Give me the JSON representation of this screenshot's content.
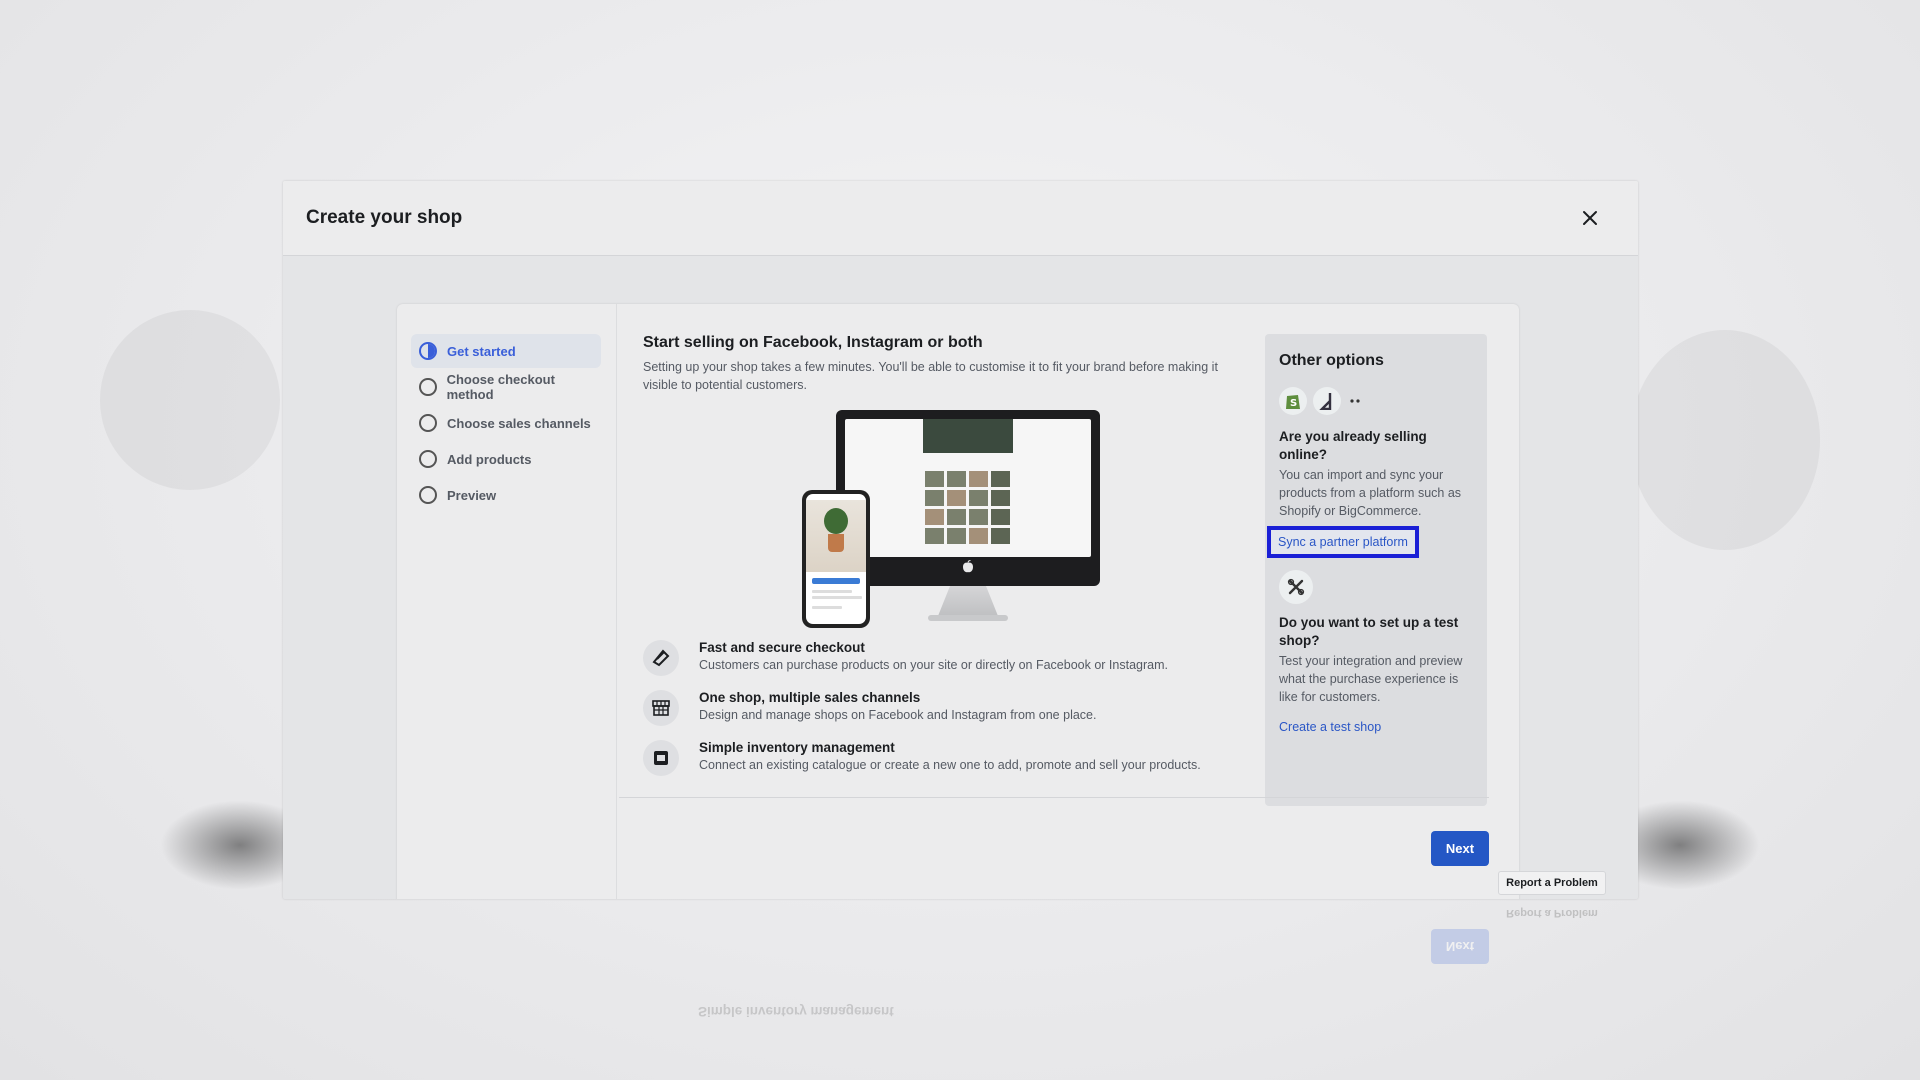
{
  "modal": {
    "title": "Create your shop"
  },
  "steps": [
    {
      "label": "Get started",
      "active": true
    },
    {
      "label": "Choose checkout method",
      "active": false
    },
    {
      "label": "Choose sales channels",
      "active": false
    },
    {
      "label": "Add products",
      "active": false
    },
    {
      "label": "Preview",
      "active": false
    }
  ],
  "main": {
    "heading": "Start selling on Facebook, Instagram or both",
    "description": "Setting up your shop takes a few minutes. You'll be able to customise it to fit your brand before making it visible to potential customers.",
    "features": [
      {
        "icon": "card-icon",
        "title": "Fast and secure checkout",
        "description": "Customers can purchase products on your site or directly on Facebook or Instagram."
      },
      {
        "icon": "storefront-icon",
        "title": "One shop, multiple sales channels",
        "description": "Design and manage shops on Facebook and Instagram from one place."
      },
      {
        "icon": "inventory-icon",
        "title": "Simple inventory management",
        "description": "Connect an existing catalogue or create a new one to add, promote and sell your products."
      }
    ]
  },
  "other_options": {
    "title": "Other options",
    "partner_question": "Are you already selling online?",
    "partner_text": "You can import and sync your products from a platform such as Shopify or BigCommerce.",
    "partner_link": "Sync a partner platform",
    "test_question": "Do you want to set up a test shop?",
    "test_text": "Test your integration and preview what the purchase experience is like for customers.",
    "test_link": "Create a test shop"
  },
  "footer": {
    "next_label": "Next",
    "report_label": "Report a Problem"
  },
  "colors": {
    "accent": "#2457c5",
    "highlight_border": "#1a1fd6",
    "link": "#2a56c6"
  }
}
